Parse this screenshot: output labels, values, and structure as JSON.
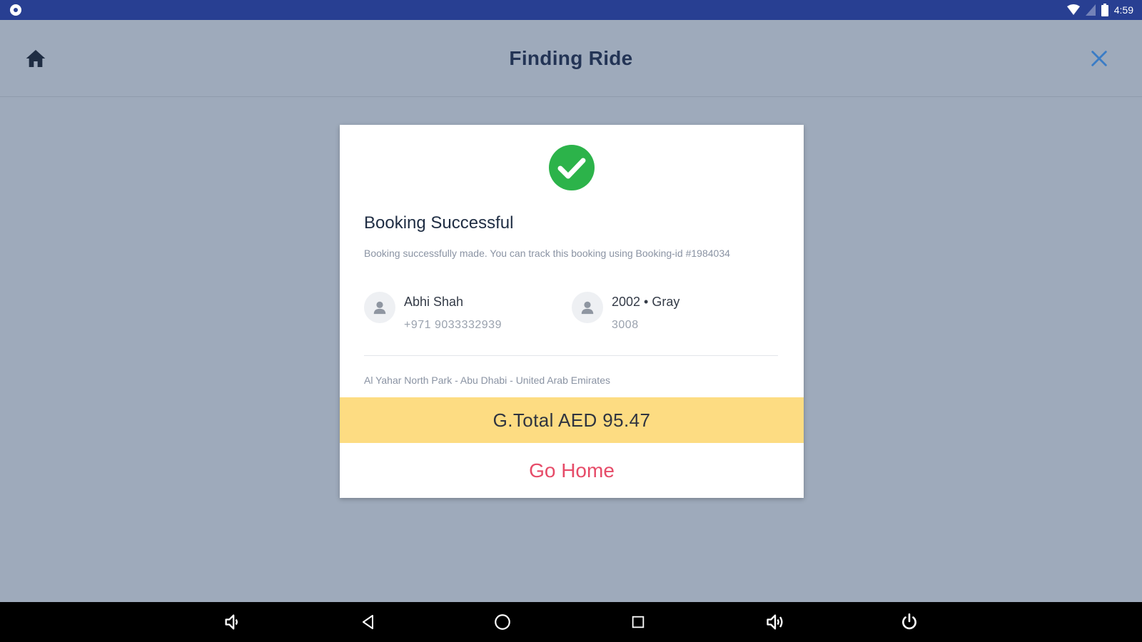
{
  "status_bar": {
    "time": "4:59",
    "background_color": "#283f92",
    "left_icon": "gear-icon",
    "right_icons": [
      "wifi-icon",
      "signal-icon",
      "battery-icon"
    ]
  },
  "app_bar": {
    "title": "Finding Ride",
    "home_icon": "home-icon",
    "close_icon": "close-icon",
    "accent_color": "#3a7cc6"
  },
  "dialog": {
    "status_icon": "check-circle-icon",
    "status_color": "#2cb34a",
    "title": "Booking Successful",
    "message": "Booking successfully made. You can track this booking using Booking-id #1984034",
    "driver": {
      "name": "Abhi Shah",
      "phone": "+971 9033332939",
      "avatar_icon": "person-icon"
    },
    "vehicle": {
      "description": "2002 • Gray",
      "number": "3008",
      "avatar_icon": "person-icon"
    },
    "address": "Al Yahar North Park - Abu Dhabi - United Arab Emirates",
    "total_label": "G.Total AED 95.47",
    "total_bar_color": "#fddc82",
    "go_home_label": "Go Home",
    "go_home_color": "#e64b68"
  },
  "nav_bar": {
    "buttons": [
      "volume-down-icon",
      "back-icon",
      "home-circle-icon",
      "recents-icon",
      "volume-up-icon",
      "power-icon"
    ]
  }
}
